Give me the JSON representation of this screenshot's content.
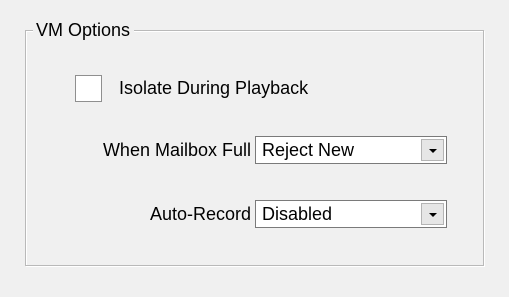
{
  "group": {
    "title": "VM Options"
  },
  "isolate": {
    "label": "Isolate During Playback",
    "checked": false
  },
  "mailbox_full": {
    "label": "When Mailbox Full",
    "value": "Reject New"
  },
  "auto_record": {
    "label": "Auto-Record",
    "value": "Disabled"
  },
  "icons": {
    "dropdown": "chevron-down-icon"
  },
  "colors": {
    "background": "#f0f0f0",
    "field_background": "#ffffff",
    "border": "#b9b9b9"
  }
}
